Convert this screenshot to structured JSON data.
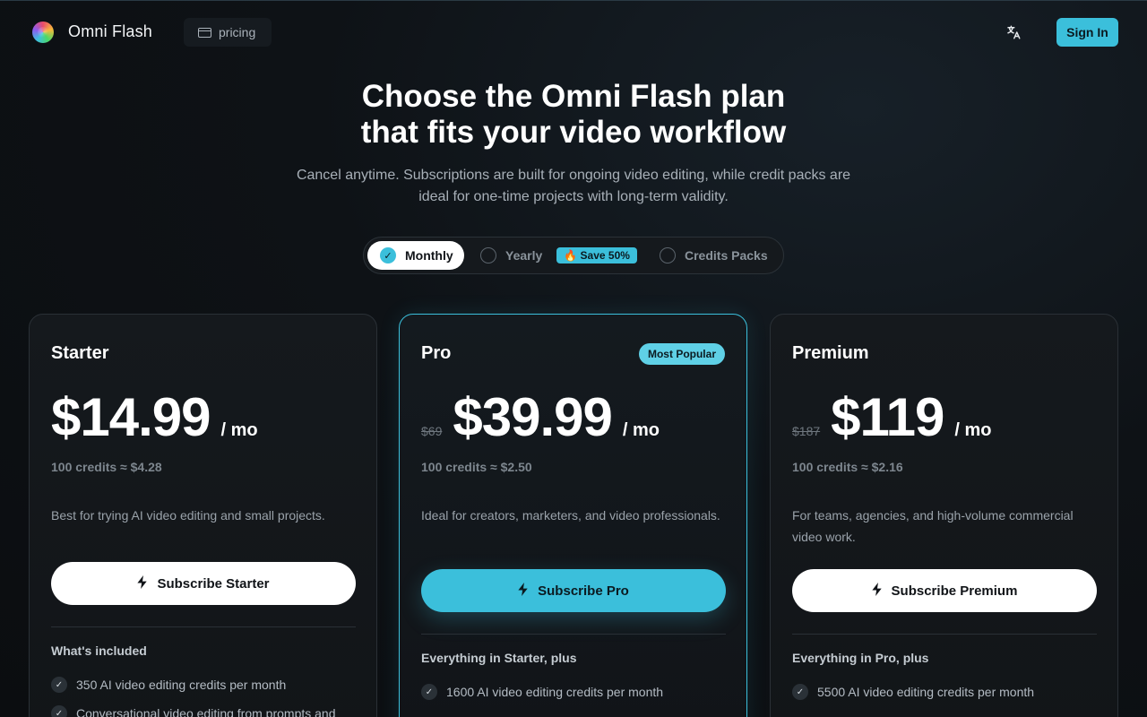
{
  "header": {
    "brand": "Omni Flash",
    "nav_label": "pricing",
    "signin_label": "Sign In"
  },
  "hero": {
    "title_line1": "Choose the Omni Flash plan",
    "title_line2": "that fits your video workflow",
    "subtitle_line1": "Cancel anytime. Subscriptions are built for ongoing video editing, while credit packs are",
    "subtitle_line2": "ideal for one-time projects with long-term validity."
  },
  "billing_toggle": {
    "monthly": "Monthly",
    "yearly": "Yearly",
    "save_badge": "🔥 Save 50%",
    "credits_packs": "Credits Packs",
    "selected": "Monthly"
  },
  "plans": [
    {
      "name": "Starter",
      "old_price": "",
      "price": "$14.99",
      "period": "/ mo",
      "credits_note": "100 credits ≈ $4.28",
      "description": "Best for trying AI video editing and small projects.",
      "cta": "Subscribe Starter",
      "includes_heading": "What's included",
      "features": [
        "350 AI video editing credits per month",
        "Conversational video editing from prompts and"
      ]
    },
    {
      "name": "Pro",
      "badge": "Most Popular",
      "old_price": "$69",
      "price": "$39.99",
      "period": "/ mo",
      "credits_note": "100 credits ≈ $2.50",
      "description": "Ideal for creators, marketers, and video professionals.",
      "cta": "Subscribe Pro",
      "includes_heading": "Everything in Starter, plus",
      "features": [
        "1600 AI video editing credits per month"
      ]
    },
    {
      "name": "Premium",
      "old_price": "$187",
      "price": "$119",
      "period": "/ mo",
      "credits_note": "100 credits ≈ $2.16",
      "description": "For teams, agencies, and high-volume commercial video work.",
      "cta": "Subscribe Premium",
      "includes_heading": "Everything in Pro, plus",
      "features": [
        "5500 AI video editing credits per month"
      ]
    }
  ],
  "colors": {
    "accent": "#3bbfdb",
    "background": "#0e1216",
    "card": "#15191d"
  },
  "icons": {
    "logo": "omni-flash-logo",
    "nav": "credit-card-icon",
    "language": "translate-icon",
    "cta": "bolt-icon",
    "feature": "check-icon"
  }
}
